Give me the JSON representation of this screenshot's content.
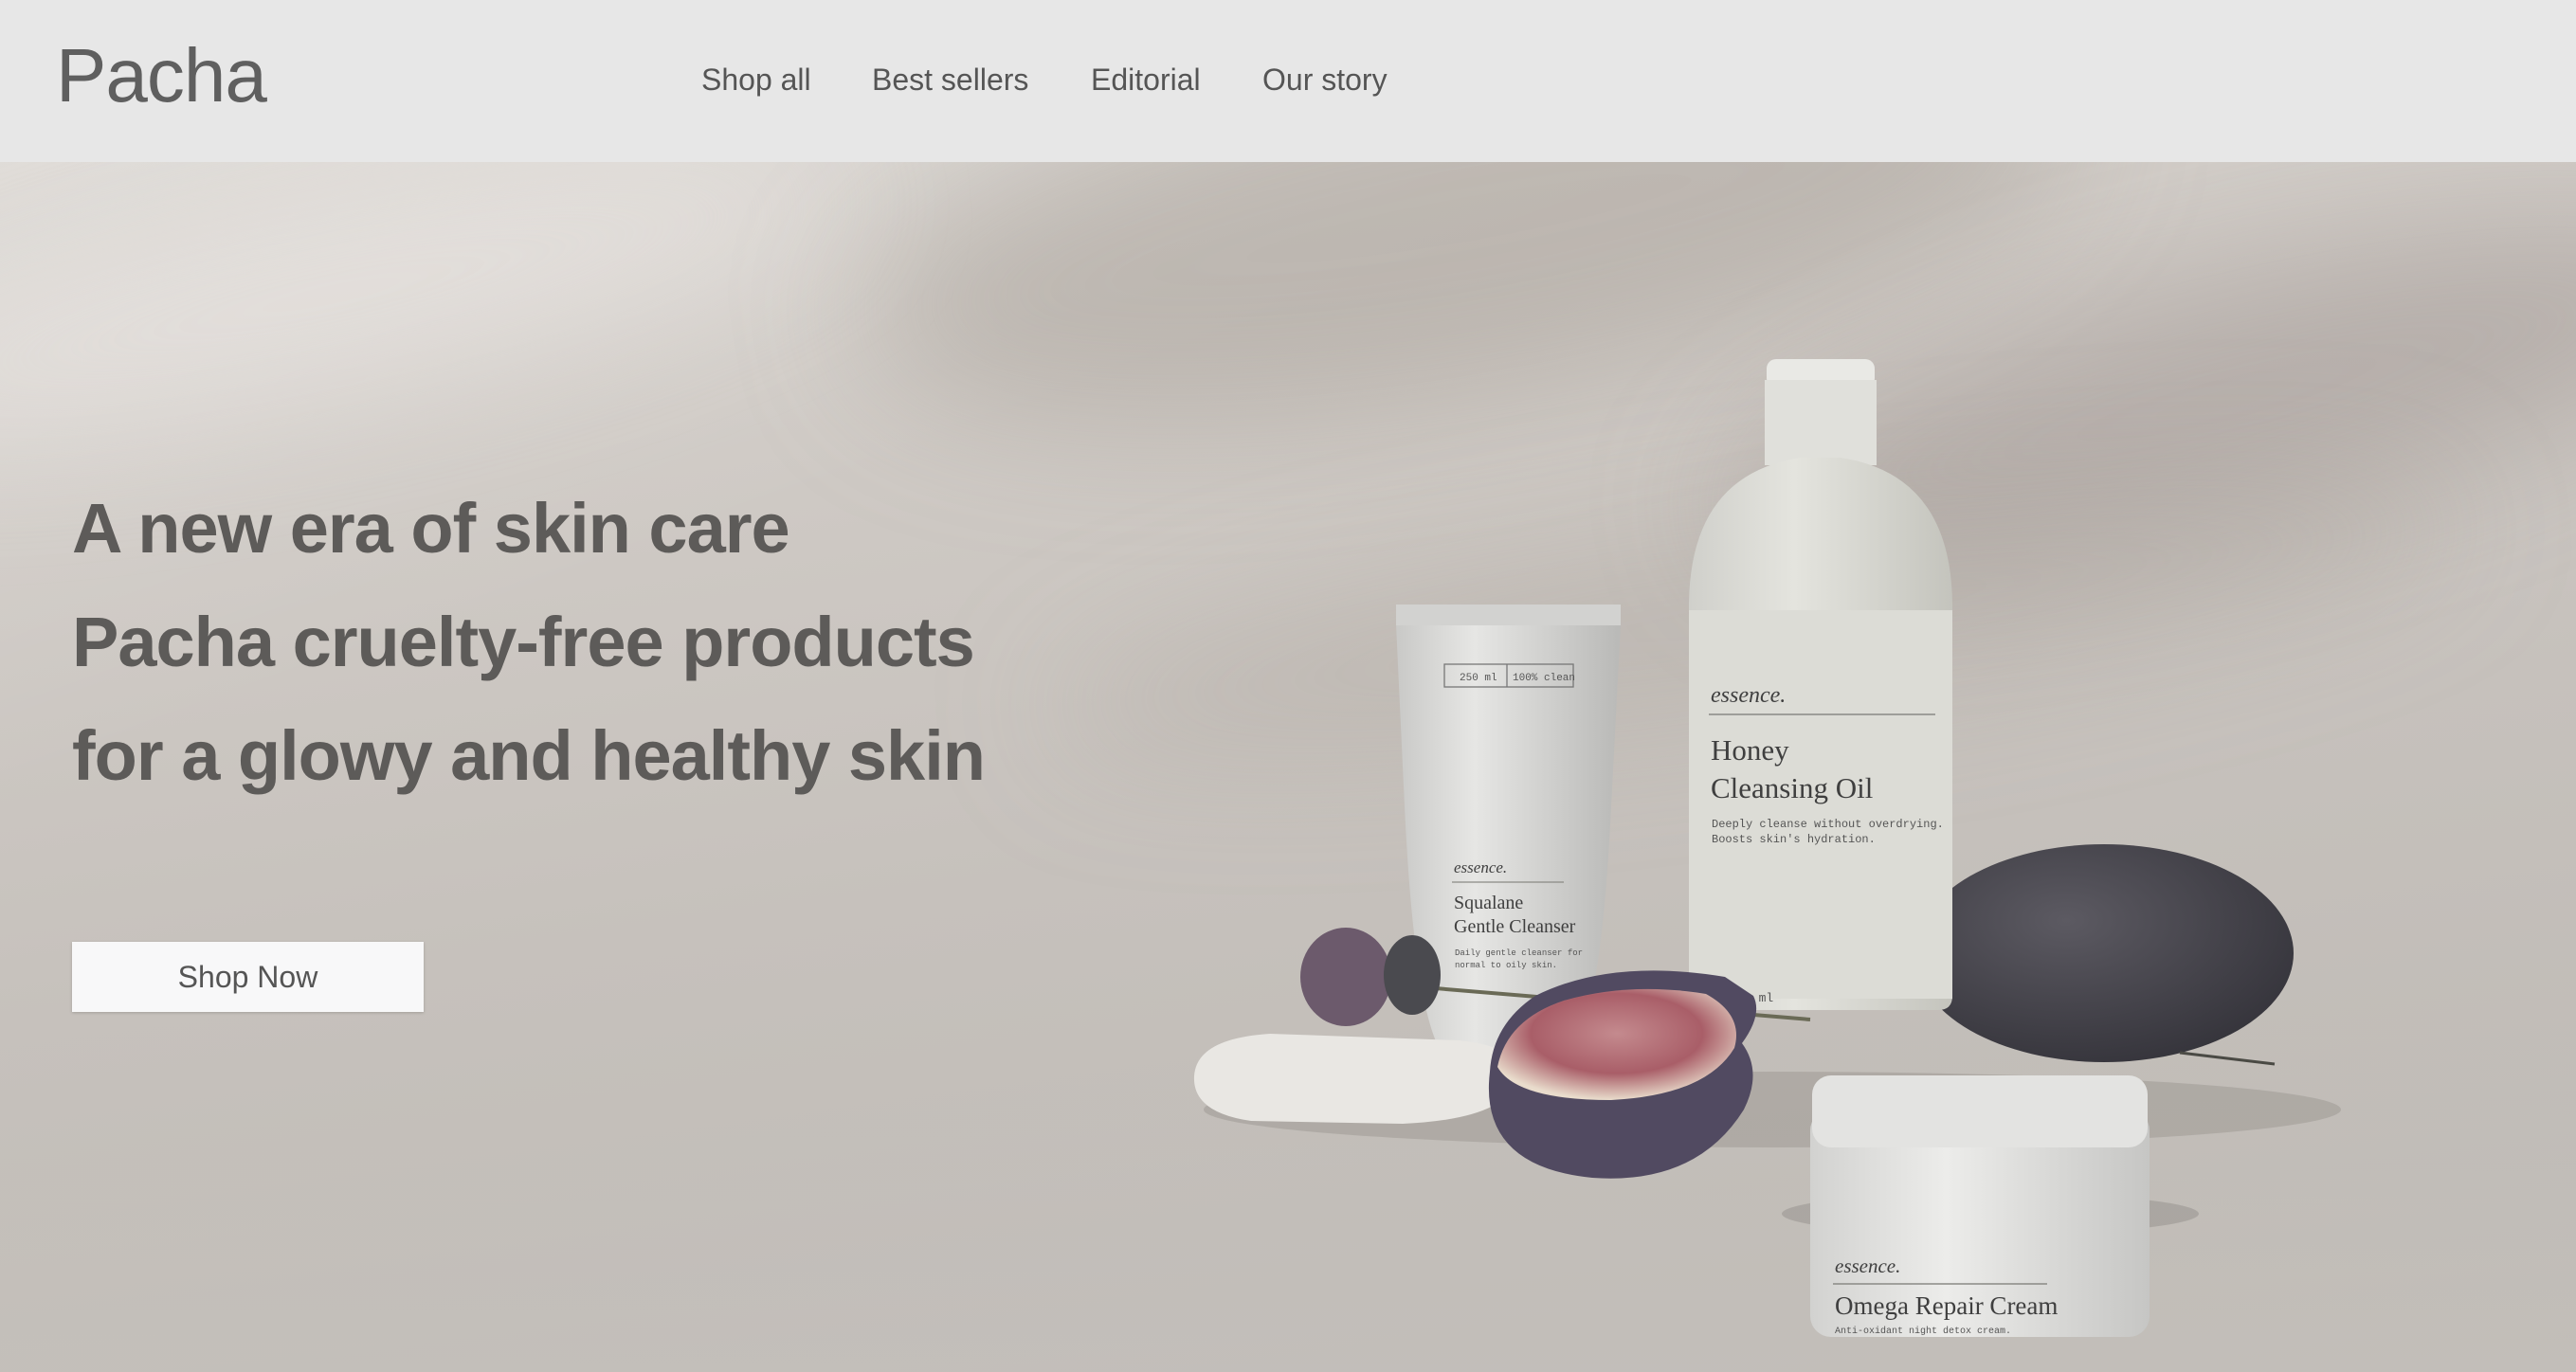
{
  "brand": {
    "logo": "Pacha"
  },
  "nav": {
    "items": [
      {
        "label": "Shop all"
      },
      {
        "label": "Best sellers"
      },
      {
        "label": "Editorial"
      },
      {
        "label": "Our story"
      }
    ]
  },
  "hero": {
    "headline": [
      "A new era of skin care",
      "Pacha cruelty-free products",
      "for a glowy and healthy skin"
    ],
    "cta_label": "Shop Now"
  },
  "products": {
    "tube": {
      "brand": "essence.",
      "name_line1": "Squalane",
      "name_line2": "Gentle Cleanser",
      "desc_line1": "Daily gentle cleanser for",
      "desc_line2": "normal to oily skin.",
      "badge_left": "250 ml",
      "badge_right": "100% clean"
    },
    "bottle": {
      "brand": "essence.",
      "name_line1": "Honey",
      "name_line2": "Cleansing Oil",
      "desc_line1": "Deeply cleanse without overdrying.",
      "desc_line2": "Boosts skin's hydration.",
      "volume": "0 ml"
    },
    "jar": {
      "brand": "essence.",
      "name": "Omega Repair Cream",
      "desc": "Anti-oxidant night detox cream."
    }
  },
  "colors": {
    "header_bg": "#e7e7e7",
    "text": "#5d5b59",
    "cta_bg": "#f8f8f9"
  }
}
